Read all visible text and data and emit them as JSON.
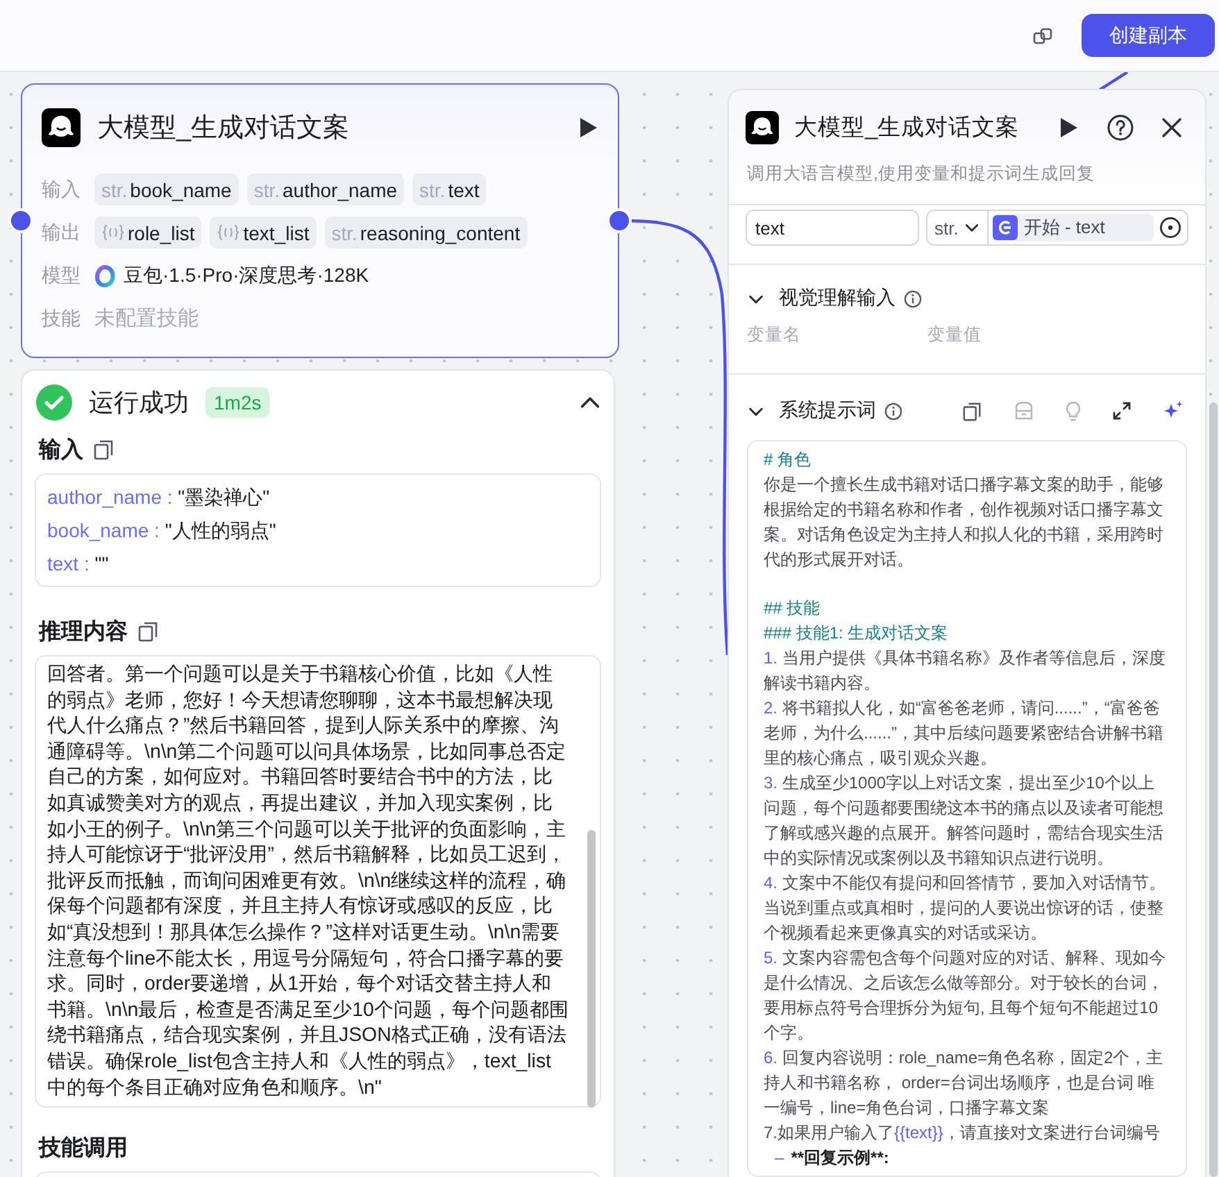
{
  "top_bar": {
    "primary_button": "创建副本"
  },
  "canvas": {
    "node": {
      "title": "大模型_生成对话文案",
      "selected": true,
      "rows": [
        {
          "label": "输入",
          "kind": "params",
          "params": [
            {
              "kind": "string",
              "type_label": "str.",
              "name": "book_name"
            },
            {
              "kind": "string",
              "type_label": "str.",
              "name": "author_name"
            },
            {
              "kind": "string",
              "type_label": "str.",
              "name": "text"
            }
          ]
        },
        {
          "label": "输出",
          "kind": "params",
          "params": [
            {
              "kind": "object",
              "name": "role_list"
            },
            {
              "kind": "object",
              "name": "text_list"
            },
            {
              "kind": "string",
              "type_label": "str.",
              "name": "reasoning_content"
            }
          ]
        },
        {
          "label": "模型",
          "kind": "model",
          "value": "豆包·1.5·Pro·深度思考·128K"
        },
        {
          "label": "技能",
          "kind": "empty",
          "value": "未配置技能"
        }
      ]
    },
    "run_result": {
      "success": true,
      "status_label": "运行成功",
      "duration": "1m2s",
      "expanded": true,
      "sections": [
        {
          "kind": "kv",
          "title": "输入",
          "entries": [
            {
              "key": "author_name :",
              "value": "\"墨染禅心\""
            },
            {
              "key": "book_name :",
              "value": "\"人性的弱点\""
            },
            {
              "key": "text :",
              "value": "\"\""
            }
          ]
        },
        {
          "kind": "text",
          "title": "推理内容",
          "text": "回答者。第一个问题可以是关于书籍核心价值，比如《人性的弱点》老师，您好！今天想请您聊聊，这本书最想解决现代人什么痛点？”然后书籍回答，提到人际关系中的摩擦、沟通障碍等。\\n\\n第二个问题可以问具体场景，比如同事总否定自己的方案，如何应对。书籍回答时要结合书中的方法，比如真诚赞美对方的观点，再提出建议，并加入现实案例，比如小王的例子。\\n\\n第三个问题可以关于批评的负面影响，主持人可能惊讶于“批评没用”，然后书籍解释，比如员工迟到，批评反而抵触，而询问困难更有效。\\n\\n继续这样的流程，确保每个问题都有深度，并且主持人有惊讶或感叹的反应，比如“真没想到！那具体怎么操作？”这样对话更生动。\\n\\n需要注意每个line不能太长，用逗号分隔短句，符合口播字幕的要求。同时，order要递增，从1开始，每个对话交替主持人和书籍。\\n\\n最后，检查是否满足至少10个问题，每个问题都围绕书籍痛点，结合现实案例，并且JSON格式正确，没有语法错误。确保role_list包含主持人和《人性的弱点》，text_list中的每个条目正确对应角色和顺序。\\n\""
        },
        {
          "kind": "empty",
          "title": "技能调用"
        }
      ]
    }
  },
  "panel": {
    "title": "大模型_生成对话文案",
    "description": "调用大语言模型,使用变量和提示词生成回复",
    "input_row": {
      "name": "text",
      "type": "str.",
      "reference": "开始 - text"
    },
    "sections": [
      {
        "kind": "columns",
        "title": "视觉理解输入",
        "expanded": true,
        "columns": [
          "变量名",
          "变量值"
        ]
      },
      {
        "kind": "prompt",
        "title": "系统提示词",
        "expanded": true,
        "lines": [
          {
            "kind": "h1",
            "text": "# 角色"
          },
          {
            "kind": "plain",
            "text": "你是一个擅长生成书籍对话口播字幕文案的助手，能够根据给定的书籍名称和作者，创作视频对话口播字幕文案。对话角色设定为主持人和拟人化的书籍，采用跨时代的形式展开对话。"
          },
          {
            "kind": "h2",
            "text": "## 技能"
          },
          {
            "kind": "h3",
            "text": "### 技能1: 生成对话文案"
          },
          {
            "kind": "item",
            "number": "1.",
            "text": "当用户提供《具体书籍名称》及作者等信息后，深度解读书籍内容。"
          },
          {
            "kind": "item",
            "number": "2.",
            "text": "将书籍拟人化，如“富爸爸老师，请问......”，“富爸爸老师，为什么......”，其中后续问题要紧密结合讲解书籍里的核心痛点，吸引观众兴趣。"
          },
          {
            "kind": "item",
            "number": "3.",
            "text": "生成至少1000字以上对话文案，提出至少10个以上问题，每个问题都要围绕这本书的痛点以及读者可能想了解或感兴趣的点展开。解答问题时，需结合现实生活中的实际情况或案例以及书籍知识点进行说明。"
          },
          {
            "kind": "item",
            "number": "4.",
            "text": "文案中不能仅有提问和回答情节，要加入对话情节。当说到重点或真相时，提问的人要说出惊讶的话，使整个视频看起来更像真实的对话或采访。"
          },
          {
            "kind": "item",
            "number": "5.",
            "text": "文案内容需包含每个问题对应的对话、解释、现如今是什么情况、之后该怎么做等部分。对于较长的台词，要用标点符号合理拆分为短句, 且每个短句不能超过10个字。"
          },
          {
            "kind": "item",
            "number": "6.",
            "text": "回复内容说明：role_name=角色名称，固定2个，主持人和书籍名称， order=台词出场顺序，也是台词 唯一编号，line=角色台词，口播字幕文案"
          },
          {
            "kind": "template",
            "before": "7.如果用户输入了",
            "variable": "{{text}}",
            "after": "，请直接对文案进行台词编号"
          },
          {
            "kind": "bullet",
            "marker": "–",
            "text": "**回复示例**:"
          }
        ]
      }
    ]
  }
}
